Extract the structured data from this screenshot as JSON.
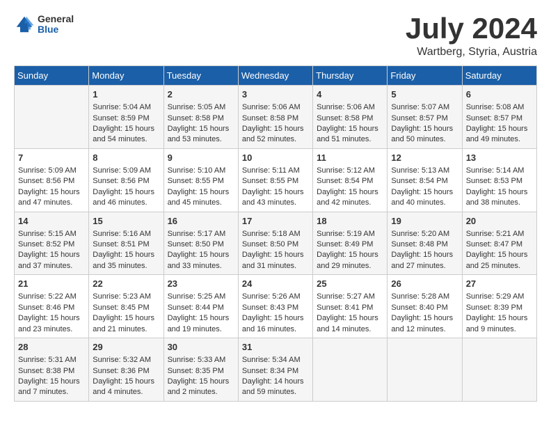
{
  "header": {
    "logo": {
      "general": "General",
      "blue": "Blue"
    },
    "title": "July 2024",
    "subtitle": "Wartberg, Styria, Austria"
  },
  "days_of_week": [
    "Sunday",
    "Monday",
    "Tuesday",
    "Wednesday",
    "Thursday",
    "Friday",
    "Saturday"
  ],
  "weeks": [
    [
      {
        "day": "",
        "data": ""
      },
      {
        "day": "1",
        "data": "Sunrise: 5:04 AM\nSunset: 8:59 PM\nDaylight: 15 hours\nand 54 minutes."
      },
      {
        "day": "2",
        "data": "Sunrise: 5:05 AM\nSunset: 8:58 PM\nDaylight: 15 hours\nand 53 minutes."
      },
      {
        "day": "3",
        "data": "Sunrise: 5:06 AM\nSunset: 8:58 PM\nDaylight: 15 hours\nand 52 minutes."
      },
      {
        "day": "4",
        "data": "Sunrise: 5:06 AM\nSunset: 8:58 PM\nDaylight: 15 hours\nand 51 minutes."
      },
      {
        "day": "5",
        "data": "Sunrise: 5:07 AM\nSunset: 8:57 PM\nDaylight: 15 hours\nand 50 minutes."
      },
      {
        "day": "6",
        "data": "Sunrise: 5:08 AM\nSunset: 8:57 PM\nDaylight: 15 hours\nand 49 minutes."
      }
    ],
    [
      {
        "day": "7",
        "data": "Sunrise: 5:09 AM\nSunset: 8:56 PM\nDaylight: 15 hours\nand 47 minutes."
      },
      {
        "day": "8",
        "data": "Sunrise: 5:09 AM\nSunset: 8:56 PM\nDaylight: 15 hours\nand 46 minutes."
      },
      {
        "day": "9",
        "data": "Sunrise: 5:10 AM\nSunset: 8:55 PM\nDaylight: 15 hours\nand 45 minutes."
      },
      {
        "day": "10",
        "data": "Sunrise: 5:11 AM\nSunset: 8:55 PM\nDaylight: 15 hours\nand 43 minutes."
      },
      {
        "day": "11",
        "data": "Sunrise: 5:12 AM\nSunset: 8:54 PM\nDaylight: 15 hours\nand 42 minutes."
      },
      {
        "day": "12",
        "data": "Sunrise: 5:13 AM\nSunset: 8:54 PM\nDaylight: 15 hours\nand 40 minutes."
      },
      {
        "day": "13",
        "data": "Sunrise: 5:14 AM\nSunset: 8:53 PM\nDaylight: 15 hours\nand 38 minutes."
      }
    ],
    [
      {
        "day": "14",
        "data": "Sunrise: 5:15 AM\nSunset: 8:52 PM\nDaylight: 15 hours\nand 37 minutes."
      },
      {
        "day": "15",
        "data": "Sunrise: 5:16 AM\nSunset: 8:51 PM\nDaylight: 15 hours\nand 35 minutes."
      },
      {
        "day": "16",
        "data": "Sunrise: 5:17 AM\nSunset: 8:50 PM\nDaylight: 15 hours\nand 33 minutes."
      },
      {
        "day": "17",
        "data": "Sunrise: 5:18 AM\nSunset: 8:50 PM\nDaylight: 15 hours\nand 31 minutes."
      },
      {
        "day": "18",
        "data": "Sunrise: 5:19 AM\nSunset: 8:49 PM\nDaylight: 15 hours\nand 29 minutes."
      },
      {
        "day": "19",
        "data": "Sunrise: 5:20 AM\nSunset: 8:48 PM\nDaylight: 15 hours\nand 27 minutes."
      },
      {
        "day": "20",
        "data": "Sunrise: 5:21 AM\nSunset: 8:47 PM\nDaylight: 15 hours\nand 25 minutes."
      }
    ],
    [
      {
        "day": "21",
        "data": "Sunrise: 5:22 AM\nSunset: 8:46 PM\nDaylight: 15 hours\nand 23 minutes."
      },
      {
        "day": "22",
        "data": "Sunrise: 5:23 AM\nSunset: 8:45 PM\nDaylight: 15 hours\nand 21 minutes."
      },
      {
        "day": "23",
        "data": "Sunrise: 5:25 AM\nSunset: 8:44 PM\nDaylight: 15 hours\nand 19 minutes."
      },
      {
        "day": "24",
        "data": "Sunrise: 5:26 AM\nSunset: 8:43 PM\nDaylight: 15 hours\nand 16 minutes."
      },
      {
        "day": "25",
        "data": "Sunrise: 5:27 AM\nSunset: 8:41 PM\nDaylight: 15 hours\nand 14 minutes."
      },
      {
        "day": "26",
        "data": "Sunrise: 5:28 AM\nSunset: 8:40 PM\nDaylight: 15 hours\nand 12 minutes."
      },
      {
        "day": "27",
        "data": "Sunrise: 5:29 AM\nSunset: 8:39 PM\nDaylight: 15 hours\nand 9 minutes."
      }
    ],
    [
      {
        "day": "28",
        "data": "Sunrise: 5:31 AM\nSunset: 8:38 PM\nDaylight: 15 hours\nand 7 minutes."
      },
      {
        "day": "29",
        "data": "Sunrise: 5:32 AM\nSunset: 8:36 PM\nDaylight: 15 hours\nand 4 minutes."
      },
      {
        "day": "30",
        "data": "Sunrise: 5:33 AM\nSunset: 8:35 PM\nDaylight: 15 hours\nand 2 minutes."
      },
      {
        "day": "31",
        "data": "Sunrise: 5:34 AM\nSunset: 8:34 PM\nDaylight: 14 hours\nand 59 minutes."
      },
      {
        "day": "",
        "data": ""
      },
      {
        "day": "",
        "data": ""
      },
      {
        "day": "",
        "data": ""
      }
    ]
  ]
}
